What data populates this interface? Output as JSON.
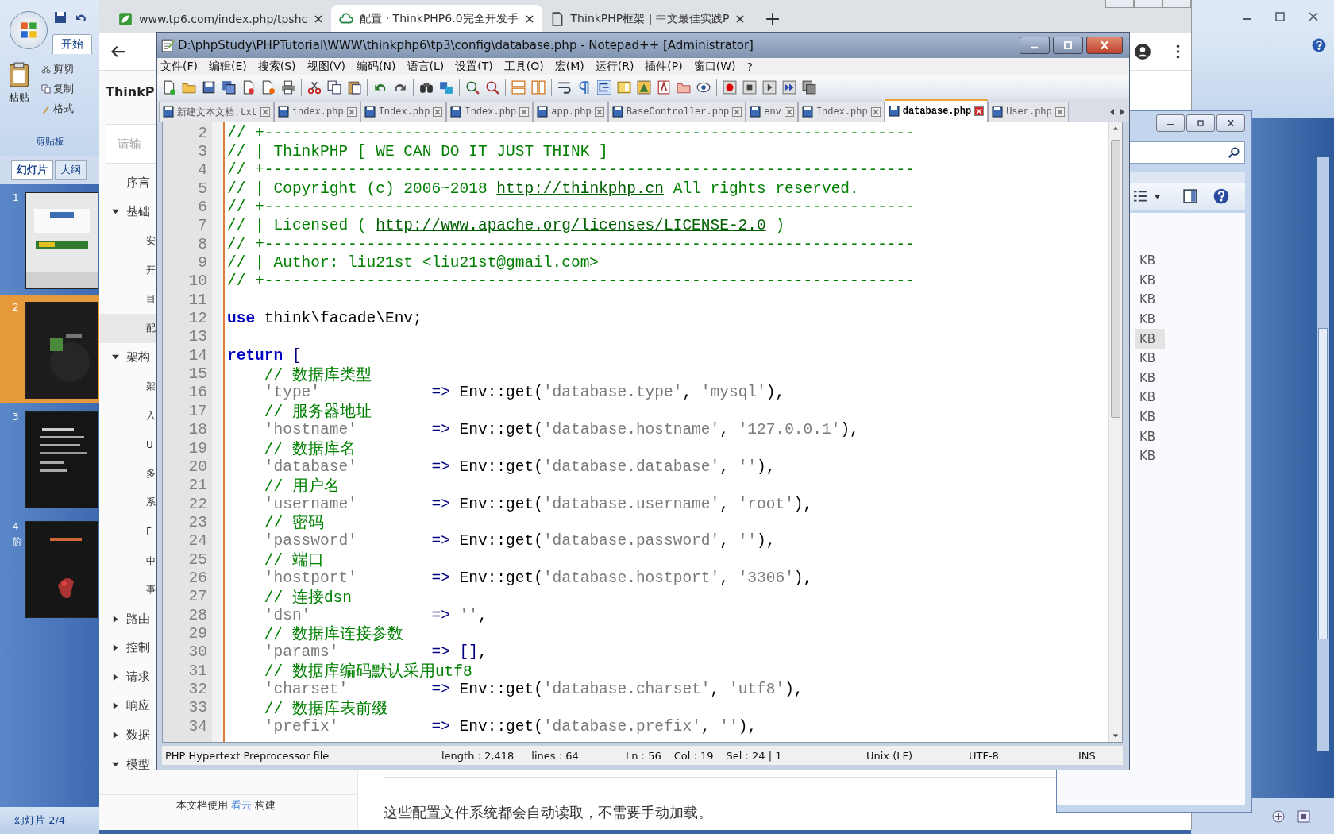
{
  "powerpoint": {
    "ribbon_tab": "开始",
    "clipboard": {
      "paste": "粘贴",
      "cut": "剪切",
      "copy": "复制",
      "format": "格式",
      "group": "剪贴板"
    },
    "panel_tabs": [
      {
        "label": "幻灯片",
        "selected": true
      },
      {
        "label": "大纲",
        "selected": false
      }
    ],
    "slides": [
      {
        "number": "1",
        "selected": false
      },
      {
        "number": "2",
        "selected": true
      },
      {
        "number": "3",
        "selected": false
      },
      {
        "number": "4",
        "selected": false,
        "mark": "阶"
      }
    ],
    "status": "幻灯片 2/4"
  },
  "browser": {
    "tabs": [
      {
        "label": "www.tp6.com/index.php/tpshc",
        "selected": false
      },
      {
        "label": "配置 · ThinkPHP6.0完全开发手",
        "selected": true
      },
      {
        "label": "ThinkPHP框架 | 中文最佳实践P",
        "selected": false
      }
    ],
    "nav_title": "ThinkP",
    "search": {
      "placeholder": "请输"
    },
    "nav": [
      {
        "label": "序言",
        "kind": "page",
        "selected": false
      },
      {
        "label": "基础",
        "kind": "section",
        "expanded": true,
        "selected": false,
        "children": [
          {
            "label": "安",
            "selected": false
          },
          {
            "label": "开",
            "selected": false
          },
          {
            "label": "目",
            "selected": false
          },
          {
            "label": "配",
            "selected": true
          }
        ]
      },
      {
        "label": "架构",
        "kind": "section",
        "expanded": true,
        "selected": false,
        "children": [
          {
            "label": "架",
            "selected": false
          },
          {
            "label": "入",
            "selected": false
          },
          {
            "label": "U",
            "selected": false
          },
          {
            "label": "多",
            "selected": false
          },
          {
            "label": "系",
            "selected": false
          },
          {
            "label": "F",
            "selected": false
          },
          {
            "label": "中",
            "selected": false
          },
          {
            "label": "事",
            "selected": false
          }
        ]
      },
      {
        "label": "路由",
        "kind": "section",
        "expanded": false,
        "selected": false
      },
      {
        "label": "控制",
        "kind": "section",
        "expanded": false,
        "selected": false
      },
      {
        "label": "请求",
        "kind": "section",
        "expanded": false,
        "selected": false
      },
      {
        "label": "响应",
        "kind": "section",
        "expanded": false,
        "selected": false
      },
      {
        "label": "数据",
        "kind": "section",
        "expanded": false,
        "selected": false
      },
      {
        "label": "模型",
        "kind": "section",
        "expanded": true,
        "selected": false
      }
    ],
    "footer": {
      "before": "本文档使用 ",
      "link": "看云",
      "after": " 构建"
    },
    "content_text": "这些配置文件系统都会自动读取，不需要手动加载。"
  },
  "explorer": {
    "files": [
      {
        "size": "KB",
        "selected": false
      },
      {
        "size": "KB",
        "selected": false
      },
      {
        "size": "KB",
        "selected": false
      },
      {
        "size": "KB",
        "selected": false
      },
      {
        "size": "KB",
        "selected": true
      },
      {
        "size": "KB",
        "selected": false
      },
      {
        "size": "KB",
        "selected": false
      },
      {
        "size": "KB",
        "selected": false
      },
      {
        "size": "KB",
        "selected": false
      },
      {
        "size": "KB",
        "selected": false
      },
      {
        "size": "KB",
        "selected": false
      }
    ]
  },
  "notepad": {
    "title": "D:\\phpStudy\\PHPTutorial\\WWW\\thinkphp6\\tp3\\config\\database.php - Notepad++ [Administrator]",
    "menu": [
      "文件(F)",
      "编辑(E)",
      "搜索(S)",
      "视图(V)",
      "编码(N)",
      "语言(L)",
      "设置(T)",
      "工具(O)",
      "宏(M)",
      "运行(R)",
      "插件(P)",
      "窗口(W)",
      "?"
    ],
    "tabs": [
      {
        "label": "新建文本文档.txt",
        "selected": false
      },
      {
        "label": "index.php",
        "selected": false
      },
      {
        "label": "Index.php",
        "selected": false
      },
      {
        "label": "Index.php",
        "selected": false
      },
      {
        "label": "app.php",
        "selected": false
      },
      {
        "label": "BaseController.php",
        "selected": false
      },
      {
        "label": "env",
        "selected": false
      },
      {
        "label": "Index.php",
        "selected": false
      },
      {
        "label": "database.php",
        "selected": true
      },
      {
        "label": "User.php",
        "selected": false
      }
    ],
    "lines": [
      {
        "number": "2",
        "tokens": [
          {
            "kind": "comment",
            "text": "// +----------------------------------------------------------------------"
          }
        ]
      },
      {
        "number": "3",
        "tokens": [
          {
            "kind": "comment",
            "text": "// | ThinkPHP [ WE CAN DO IT JUST THINK ]"
          }
        ]
      },
      {
        "number": "4",
        "tokens": [
          {
            "kind": "comment",
            "text": "// +----------------------------------------------------------------------"
          }
        ]
      },
      {
        "number": "5",
        "tokens": [
          {
            "kind": "comment",
            "text": "// | Copyright (c) 2006~2018 "
          },
          {
            "kind": "link",
            "text": "http://thinkphp.cn"
          },
          {
            "kind": "comment",
            "text": " All rights reserved."
          }
        ]
      },
      {
        "number": "6",
        "tokens": [
          {
            "kind": "comment",
            "text": "// +----------------------------------------------------------------------"
          }
        ]
      },
      {
        "number": "7",
        "tokens": [
          {
            "kind": "comment",
            "text": "// | Licensed ( "
          },
          {
            "kind": "link",
            "text": "http://www.apache.org/licenses/LICENSE-2.0"
          },
          {
            "kind": "comment",
            "text": " )"
          }
        ]
      },
      {
        "number": "8",
        "tokens": [
          {
            "kind": "comment",
            "text": "// +----------------------------------------------------------------------"
          }
        ]
      },
      {
        "number": "9",
        "tokens": [
          {
            "kind": "comment",
            "text": "// | Author: liu21st <liu21st@gmail.com>"
          }
        ]
      },
      {
        "number": "10",
        "tokens": [
          {
            "kind": "comment",
            "text": "// +----------------------------------------------------------------------"
          }
        ]
      },
      {
        "number": "11"
      },
      {
        "number": "12",
        "tokens": [
          {
            "kind": "keyword",
            "text": "use"
          },
          {
            "kind": "plain",
            "text": " think\\facade\\Env;"
          }
        ]
      },
      {
        "number": "13"
      },
      {
        "number": "14",
        "tokens": [
          {
            "kind": "keyword",
            "text": "return"
          },
          {
            "kind": "operator",
            "text": " ["
          }
        ]
      },
      {
        "number": "15",
        "tokens": [
          {
            "kind": "comment",
            "text": "    // 数据库类型"
          }
        ]
      },
      {
        "number": "16",
        "tokens": [
          {
            "kind": "string",
            "text": "    'type'"
          },
          {
            "kind": "operator",
            "text": "            =>"
          },
          {
            "kind": "plain",
            "text": " Env::get("
          },
          {
            "kind": "string",
            "text": "'database.type'"
          },
          {
            "kind": "plain",
            "text": ", "
          },
          {
            "kind": "string",
            "text": "'mysql'"
          },
          {
            "kind": "plain",
            "text": "),"
          }
        ]
      },
      {
        "number": "17",
        "tokens": [
          {
            "kind": "comment",
            "text": "    // 服务器地址"
          }
        ]
      },
      {
        "number": "18",
        "tokens": [
          {
            "kind": "string",
            "text": "    'hostname'"
          },
          {
            "kind": "operator",
            "text": "        =>"
          },
          {
            "kind": "plain",
            "text": " Env::get("
          },
          {
            "kind": "string",
            "text": "'database.hostname'"
          },
          {
            "kind": "plain",
            "text": ", "
          },
          {
            "kind": "string",
            "text": "'127.0.0.1'"
          },
          {
            "kind": "plain",
            "text": "),"
          }
        ]
      },
      {
        "number": "19",
        "tokens": [
          {
            "kind": "comment",
            "text": "    // 数据库名"
          }
        ]
      },
      {
        "number": "20",
        "tokens": [
          {
            "kind": "string",
            "text": "    'database'"
          },
          {
            "kind": "operator",
            "text": "        =>"
          },
          {
            "kind": "plain",
            "text": " Env::get("
          },
          {
            "kind": "string",
            "text": "'database.database'"
          },
          {
            "kind": "plain",
            "text": ", "
          },
          {
            "kind": "string",
            "text": "''"
          },
          {
            "kind": "plain",
            "text": "),"
          }
        ]
      },
      {
        "number": "21",
        "tokens": [
          {
            "kind": "comment",
            "text": "    // 用户名"
          }
        ]
      },
      {
        "number": "22",
        "tokens": [
          {
            "kind": "string",
            "text": "    'username'"
          },
          {
            "kind": "operator",
            "text": "        =>"
          },
          {
            "kind": "plain",
            "text": " Env::get("
          },
          {
            "kind": "string",
            "text": "'database.username'"
          },
          {
            "kind": "plain",
            "text": ", "
          },
          {
            "kind": "string",
            "text": "'root'"
          },
          {
            "kind": "plain",
            "text": "),"
          }
        ]
      },
      {
        "number": "23",
        "tokens": [
          {
            "kind": "comment",
            "text": "    // 密码"
          }
        ]
      },
      {
        "number": "24",
        "tokens": [
          {
            "kind": "string",
            "text": "    'password'"
          },
          {
            "kind": "operator",
            "text": "        =>"
          },
          {
            "kind": "plain",
            "text": " Env::get("
          },
          {
            "kind": "string",
            "text": "'database.password'"
          },
          {
            "kind": "plain",
            "text": ", "
          },
          {
            "kind": "string",
            "text": "''"
          },
          {
            "kind": "plain",
            "text": "),"
          }
        ]
      },
      {
        "number": "25",
        "tokens": [
          {
            "kind": "comment",
            "text": "    // 端口"
          }
        ]
      },
      {
        "number": "26",
        "tokens": [
          {
            "kind": "string",
            "text": "    'hostport'"
          },
          {
            "kind": "operator",
            "text": "        =>"
          },
          {
            "kind": "plain",
            "text": " Env::get("
          },
          {
            "kind": "string",
            "text": "'database.hostport'"
          },
          {
            "kind": "plain",
            "text": ", "
          },
          {
            "kind": "string",
            "text": "'3306'"
          },
          {
            "kind": "plain",
            "text": "),"
          }
        ]
      },
      {
        "number": "27",
        "tokens": [
          {
            "kind": "comment",
            "text": "    // 连接dsn"
          }
        ]
      },
      {
        "number": "28",
        "tokens": [
          {
            "kind": "string",
            "text": "    'dsn'"
          },
          {
            "kind": "operator",
            "text": "             => "
          },
          {
            "kind": "string",
            "text": "''"
          },
          {
            "kind": "plain",
            "text": ","
          }
        ]
      },
      {
        "number": "29",
        "tokens": [
          {
            "kind": "comment",
            "text": "    // 数据库连接参数"
          }
        ]
      },
      {
        "number": "30",
        "tokens": [
          {
            "kind": "string",
            "text": "    'params'"
          },
          {
            "kind": "operator",
            "text": "          => []"
          },
          {
            "kind": "plain",
            "text": ","
          }
        ]
      },
      {
        "number": "31",
        "tokens": [
          {
            "kind": "comment",
            "text": "    // 数据库编码默认采用utf8"
          }
        ]
      },
      {
        "number": "32",
        "tokens": [
          {
            "kind": "string",
            "text": "    'charset'"
          },
          {
            "kind": "operator",
            "text": "         =>"
          },
          {
            "kind": "plain",
            "text": " Env::get("
          },
          {
            "kind": "string",
            "text": "'database.charset'"
          },
          {
            "kind": "plain",
            "text": ", "
          },
          {
            "kind": "string",
            "text": "'utf8'"
          },
          {
            "kind": "plain",
            "text": "),"
          }
        ]
      },
      {
        "number": "33",
        "tokens": [
          {
            "kind": "comment",
            "text": "    // 数据库表前缀"
          }
        ]
      },
      {
        "number": "34",
        "tokens": [
          {
            "kind": "string",
            "text": "    'prefix'"
          },
          {
            "kind": "operator",
            "text": "          =>"
          },
          {
            "kind": "plain",
            "text": " Env::get("
          },
          {
            "kind": "string",
            "text": "'database.prefix'"
          },
          {
            "kind": "plain",
            "text": ", "
          },
          {
            "kind": "string",
            "text": "''"
          },
          {
            "kind": "plain",
            "text": "),"
          }
        ]
      }
    ],
    "status_bar": {
      "file_type": "PHP Hypertext Preprocessor file",
      "length": "length : 2,418",
      "lines": "lines : 64",
      "ln": "Ln : 56",
      "col": "Col : 19",
      "sel": "Sel : 24 | 1",
      "eol": "Unix (LF)",
      "encoding": "UTF-8",
      "mode": "INS"
    }
  }
}
